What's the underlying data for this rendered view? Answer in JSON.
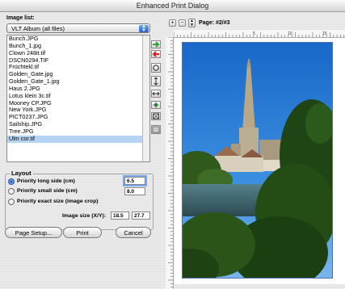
{
  "window": {
    "title": "Enhanced Print Dialog"
  },
  "image_list": {
    "label": "Image list:",
    "album_popup": "VLT Album (all files)",
    "items": [
      "Bunch.JPG",
      "Bunch_1.jpg",
      "Clown 248it.tif",
      "DSCN0294.TIF",
      "Früchtekl.tif",
      "Golden_Gate.jpg",
      "Golden_Gate_1.jpg",
      "Haus 2.JPG",
      "Lotus klein 3c.tif",
      "Mooney CP.JPG",
      "New York.JPG",
      "PICT0237.JPG",
      "Sailship.JPG",
      "Tree.JPG",
      "Ulm cor.tif"
    ],
    "selected_index": 14
  },
  "layout": {
    "title": "Layout",
    "options": [
      {
        "label": "Priority   long side (cm)",
        "value": "6.5",
        "selected": true
      },
      {
        "label": "Priority   small side (cm)",
        "value": "8.0",
        "selected": false
      },
      {
        "label": "Priority   exact size (image crop)",
        "value": "",
        "selected": false
      }
    ],
    "image_size_label": "Image size (X/Y):",
    "image_size_x": "18.5",
    "image_size_y": "27.7"
  },
  "buttons": {
    "page_setup": "Page Setup...",
    "print": "Print",
    "cancel": "Cancel"
  },
  "preview": {
    "page_label": "Page: #2/#3",
    "ruler_marks": [
      "5",
      "10",
      "15"
    ]
  },
  "tools": [
    "arrow-right-green-icon",
    "arrow-left-red-icon",
    "rotate-icon",
    "fit-vertical-icon",
    "fit-horizontal-icon",
    "center-icon",
    "fill-icon",
    "zoom-icon"
  ]
}
